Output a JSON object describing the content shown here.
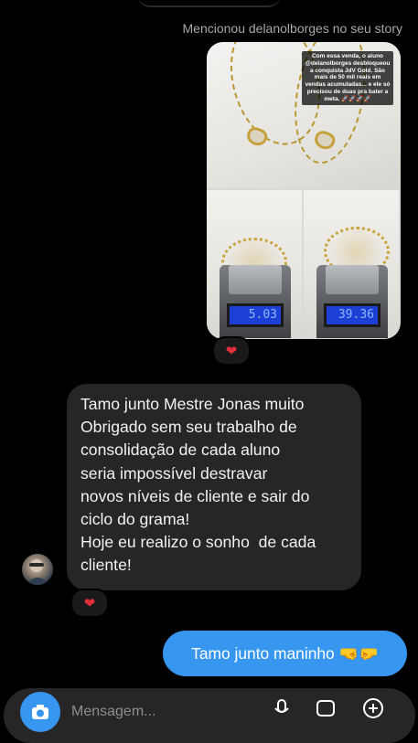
{
  "header": {
    "mention_text": "Mencionou delanolborges no seu story"
  },
  "story": {
    "overlay_text": "Com essa venda, o aluno @delanolborges desbloqueou a conquista JdV Gold. São mais de 50 mil reais em vendas acumuladas... e ele só precisou de duas pra bater a meta. 🚀🚀🚀🚀",
    "scale_left_reading": "5.03",
    "scale_right_reading": "39.36"
  },
  "reactions": {
    "story_reaction": "❤",
    "message_reaction": "❤"
  },
  "messages": {
    "incoming_text": "Tamo junto Mestre Jonas muito\nObrigado sem seu trabalho de\nconsolidação de cada aluno\nseria impossível destravar\nnovos níveis de cliente e sair do\nciclo do grama!\nHoje eu realizo o sonho  de cada\ncliente!",
    "outgoing_text": "Tamo junto maninho 🤜🤛"
  },
  "composer": {
    "placeholder": "Mensagem...",
    "icons": [
      "camera-icon",
      "microphone-icon",
      "gallery-icon",
      "add-icon"
    ]
  },
  "colors": {
    "background": "#000000",
    "incoming_bubble": "#262626",
    "outgoing_bubble": "#3797f0",
    "heart": "#e02e3b"
  }
}
